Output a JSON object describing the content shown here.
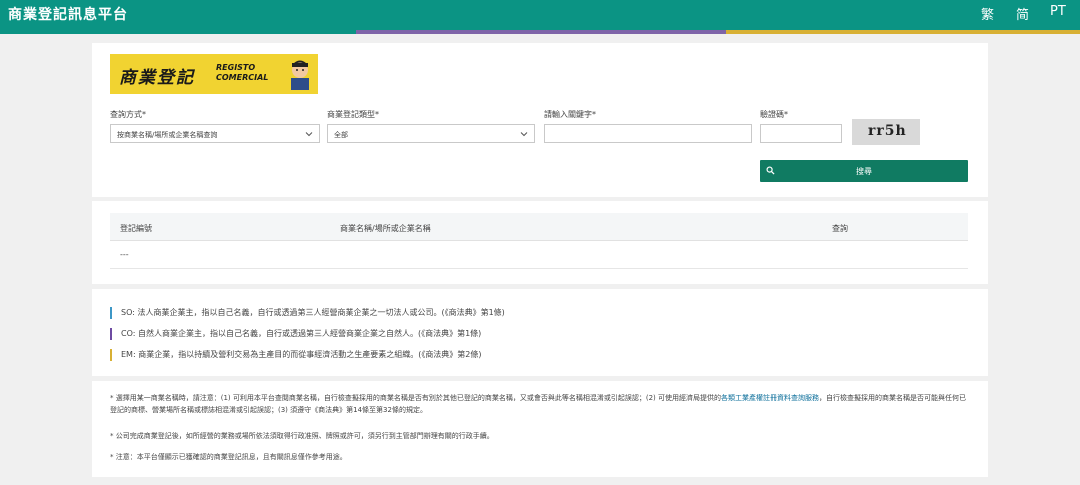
{
  "header": {
    "title": "商業登記訊息平台",
    "languages": [
      "繁",
      "简",
      "PT"
    ]
  },
  "logo": {
    "chinese_text": "商業登記",
    "registo_line1": "REGISTO",
    "registo_line2": "COMERCIAL"
  },
  "search_form": {
    "method_label": "查詢方式*",
    "method_value": "按商業名稱/場所或企業名稱查詢",
    "type_label": "商業登記類型*",
    "type_value": "全部",
    "keyword_label": "請輸入關鍵字*",
    "keyword_value": "",
    "captcha_label": "驗證碼*",
    "captcha_value": "",
    "captcha_image_text": "rr5h",
    "search_button_label": "搜尋"
  },
  "results_table": {
    "columns": [
      "登記編號",
      "商業名稱/場所或企業名稱",
      "查詢"
    ],
    "rows": [
      [
        "---"
      ]
    ]
  },
  "legend": [
    {
      "text": "SO: 法人商業企業主，指以自己名義，自行或透過第三人經營商業企業之一切法人或公司。(《商法典》第1條)",
      "color": "#3d97c6"
    },
    {
      "text": "CO: 自然人商業企業主，指以自己名義，自行或透過第三人經營商業企業之自然人。(《商法典》第1條)",
      "color": "#6e4ba2"
    },
    {
      "text": "EM: 商業企業，指以持續及營利交易為主產目的而從事經濟活動之生產要素之組織。(《商法典》第2條)",
      "color": "#d8b034"
    }
  ],
  "notes": {
    "note1_part1": "* 選擇用某一商業名稱時，請注意：(1) 可利用本平台查閱商業名稱，自行檢查擬採用的商業名稱是否有別於其他已登記的商業名稱，又或會否與此等名稱相混淆或引起誤認；(2) 可使用經濟局提供的",
    "note1_link": "各類工業產權註冊資料查詢服務",
    "note1_part2": "，自行檢查擬採用的商業名稱是否可能與任何已登記的商標、營業場所名稱或標誌相混淆或引起誤認；(3) 須遵守《商法典》第14條至第32條的規定。",
    "note2": "* 公司完成商業登記後，如所經營的業務或場所依法須取得行政准照、牌照或許可，須另行到主管部門辦理有關的行政手續。",
    "note3": "* 注意：本平台僅顯示已獲確認的商業登記訊息，且有關訊息僅作參考用途。"
  },
  "colors": {
    "header_bg": "#0b9484",
    "search_button_bg": "#107b62",
    "stripe_teal": "#0b9484",
    "stripe_purple": "#7e64a8",
    "stripe_gold": "#d8b034"
  }
}
